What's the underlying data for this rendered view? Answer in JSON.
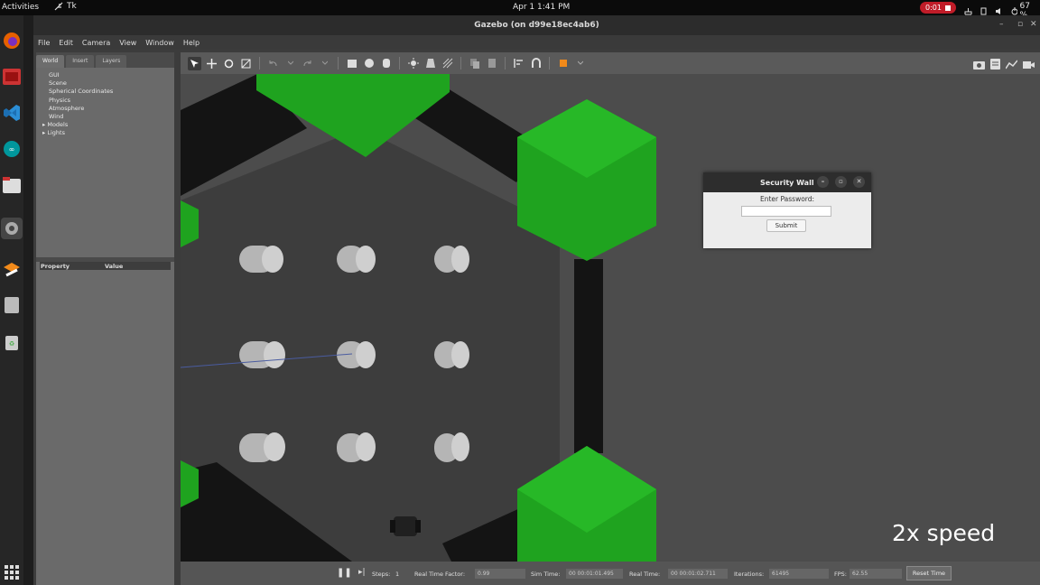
{
  "topbar": {
    "activities": "Activities",
    "app_name": "Tk",
    "clock": "Apr 1  1:41 PM",
    "recording": "0:01",
    "battery": "67 %"
  },
  "dock": {
    "items": [
      "firefox-icon",
      "terminal-icon",
      "vscode-icon",
      "arduino-icon",
      "files-icon",
      "settings-icon",
      "gazebo-icon",
      "drive-icon",
      "trash-icon",
      "app-grid-icon"
    ]
  },
  "window": {
    "title": "Gazebo (on d99e18ec4ab6)",
    "menu": [
      "File",
      "Edit",
      "Camera",
      "View",
      "Window",
      "Help"
    ]
  },
  "left_panel": {
    "tabs": [
      "World",
      "Insert",
      "Layers"
    ],
    "tree": [
      "GUI",
      "Scene",
      "Spherical Coordinates",
      "Physics",
      "Atmosphere",
      "Wind",
      "Models",
      "Lights"
    ],
    "property_header": "Property",
    "value_header": "Value"
  },
  "bottom": {
    "steps_label": "Steps:",
    "steps_value": "1",
    "rtf_label": "Real Time Factor:",
    "rtf_value": "0.99",
    "sim_label": "Sim Time:",
    "sim_value": "00 00:01:01.495",
    "real_label": "Real Time:",
    "real_value": "00 00:01:02.711",
    "iter_label": "Iterations:",
    "iter_value": "61495",
    "fps_label": "FPS:",
    "fps_value": "62.55",
    "reset_label": "Reset Time"
  },
  "dialog": {
    "title": "Security Wall",
    "prompt": "Enter Password:",
    "password_value": "",
    "submit_label": "Submit"
  },
  "overlay": {
    "speed_label": "2x speed"
  },
  "colors": {
    "accent_green": "#1fa31f",
    "wall_black": "#111111",
    "ground": "#4b4b4b",
    "record_red": "#c01c28"
  }
}
